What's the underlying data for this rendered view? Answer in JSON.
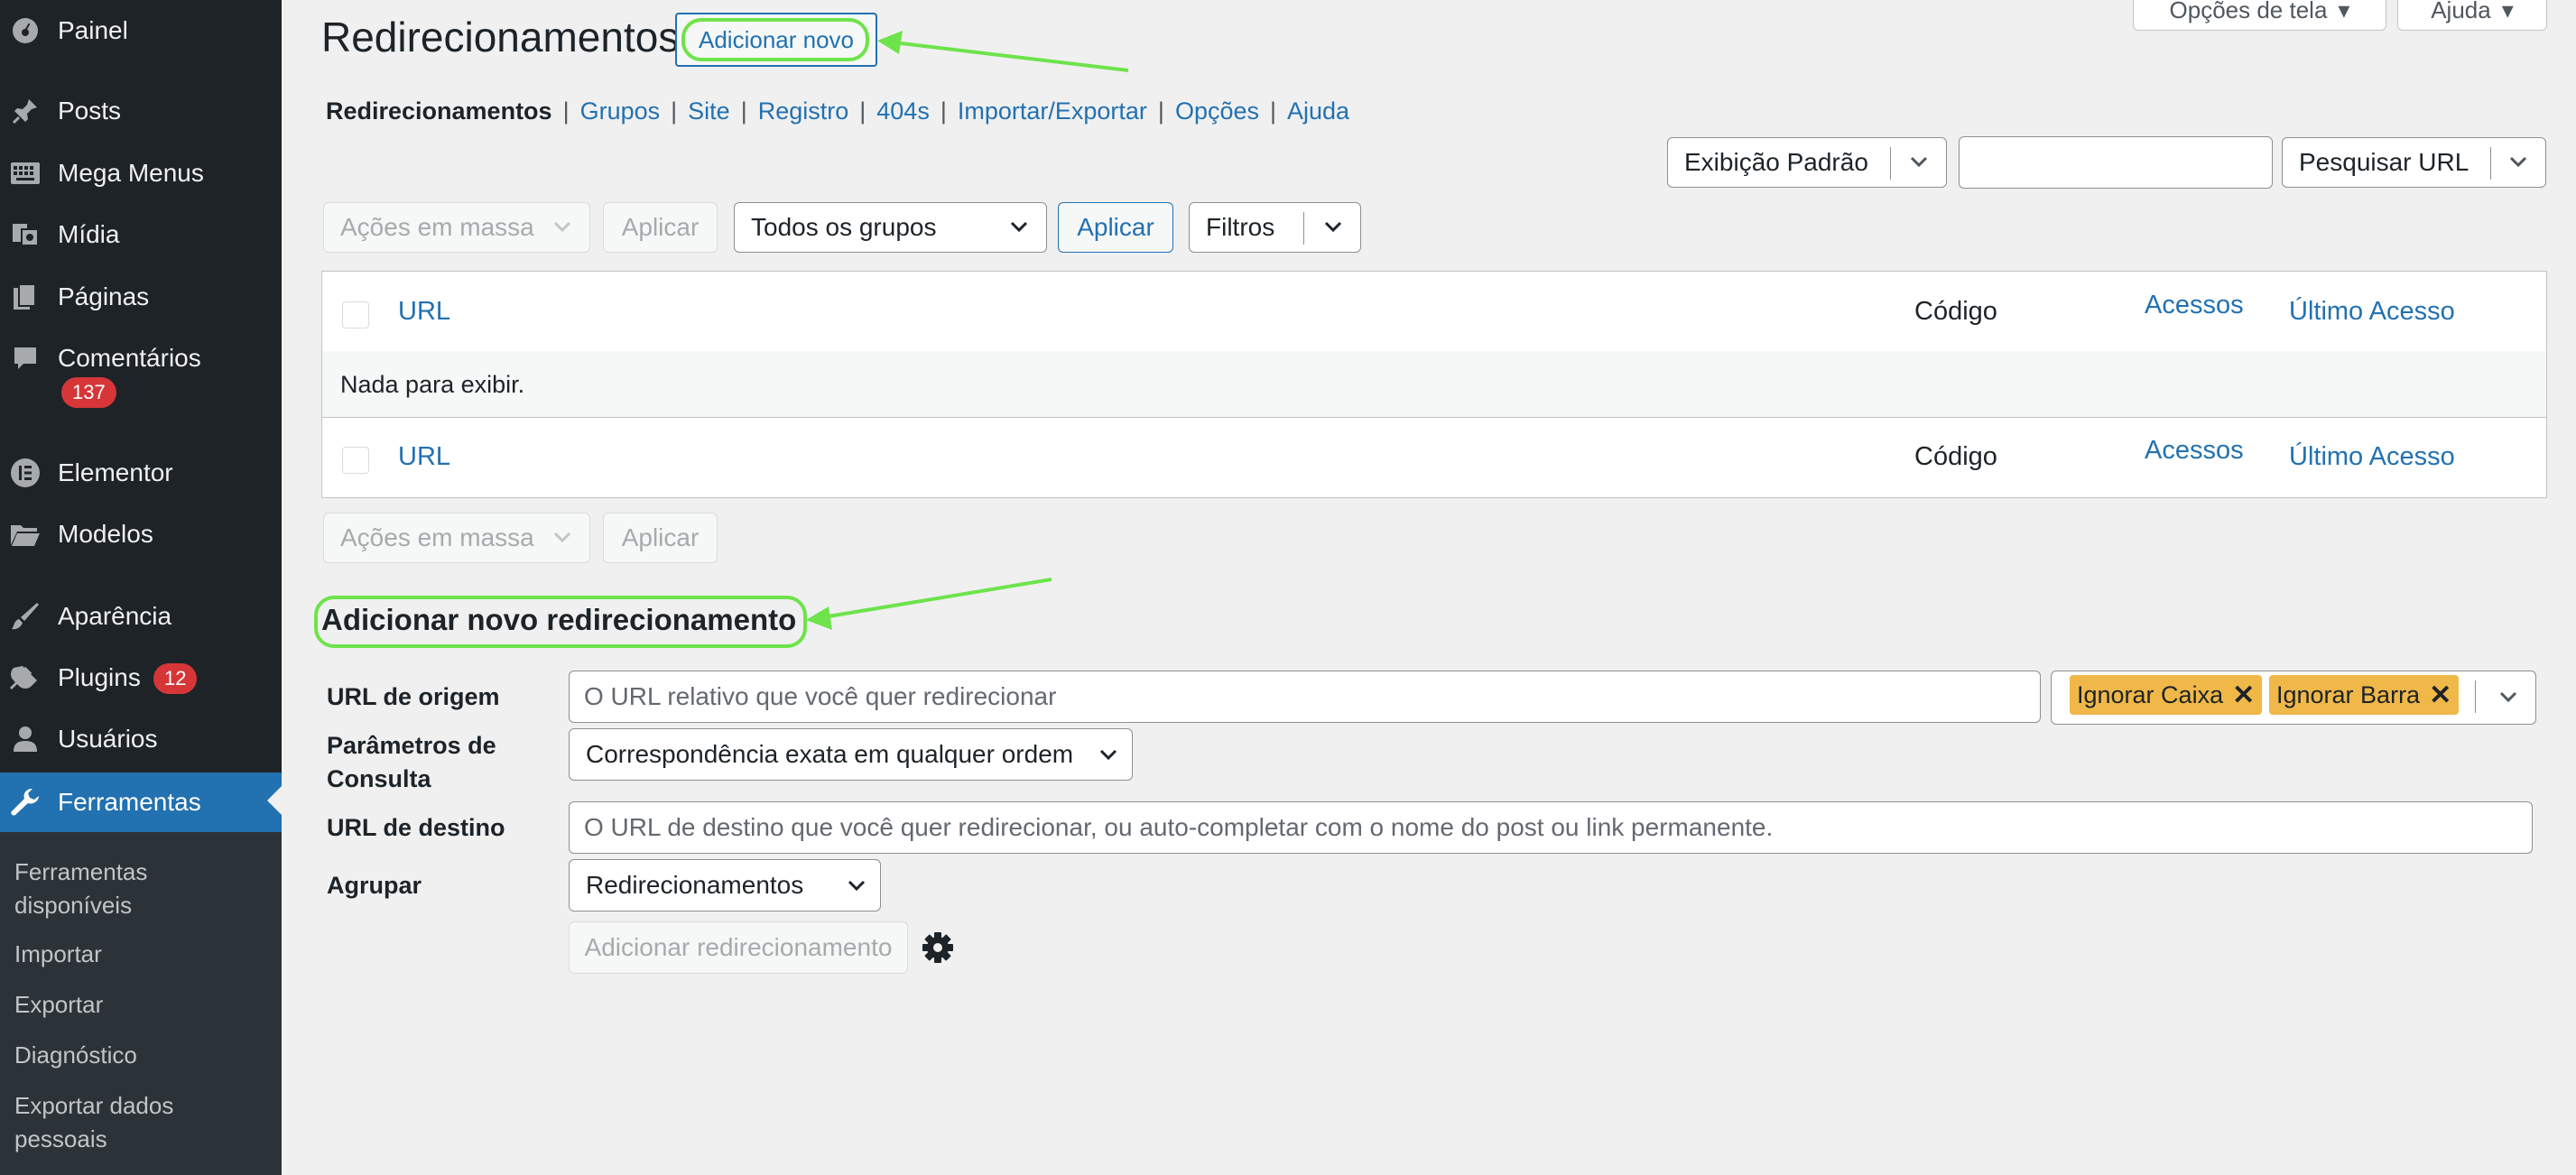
{
  "sidebar": {
    "items": [
      {
        "label": "Painel",
        "icon": "dashboard-icon"
      },
      {
        "label": "Posts",
        "icon": "pin-icon"
      },
      {
        "label": "Mega Menus",
        "icon": "keyboard-icon"
      },
      {
        "label": "Mídia",
        "icon": "media-icon"
      },
      {
        "label": "Páginas",
        "icon": "pages-icon"
      },
      {
        "label": "Comentários",
        "icon": "comment-icon",
        "badge": "137"
      },
      {
        "label": "Elementor",
        "icon": "elementor-icon"
      },
      {
        "label": "Modelos",
        "icon": "folder-icon"
      },
      {
        "label": "Aparência",
        "icon": "brush-icon"
      },
      {
        "label": "Plugins",
        "icon": "plugin-icon",
        "badge": "12"
      },
      {
        "label": "Usuários",
        "icon": "user-icon"
      },
      {
        "label": "Ferramentas",
        "icon": "wrench-icon",
        "current": true
      }
    ],
    "submenu": [
      "Ferramentas disponíveis",
      "Importar",
      "Exportar",
      "Diagnóstico",
      "Exportar dados pessoais"
    ]
  },
  "screen_options": "Opções de tela",
  "help": "Ajuda",
  "page_title": "Redirecionamentos",
  "add_new": "Adicionar novo",
  "subnav": [
    "Redirecionamentos",
    "Grupos",
    "Site",
    "Registro",
    "404s",
    "Importar/Exportar",
    "Opções",
    "Ajuda"
  ],
  "view_select": "Exibição Padrão",
  "search_value": "",
  "search_button": "Pesquisar URL",
  "bulk_actions": "Ações em massa",
  "apply": "Aplicar",
  "groups_select": "Todos os grupos",
  "apply_active": "Aplicar",
  "filters": "Filtros",
  "table": {
    "col_url": "URL",
    "col_code": "Código",
    "col_hits": "Acessos",
    "col_last": "Último Acesso",
    "empty": "Nada para exibir."
  },
  "form": {
    "title": "Adicionar novo redirecionamento",
    "source_label": "URL de origem",
    "source_placeholder": "O URL relativo que você quer redirecionar",
    "tags": [
      "Ignorar Caixa",
      "Ignorar Barra"
    ],
    "query_label": "Parâmetros de Consulta",
    "query_value": "Correspondência exata em qualquer ordem",
    "target_label": "URL de destino",
    "target_placeholder": "O URL de destino que você quer redirecionar, ou auto-completar com o nome do post ou link permanente.",
    "group_label": "Agrupar",
    "group_value": "Redirecionamentos",
    "submit": "Adicionar redirecionamento"
  },
  "colors": {
    "accent": "#2271b1",
    "sidebar": "#1d2327",
    "highlight": "#6ee34b",
    "tag": "#f0b849",
    "badge": "#d63638"
  }
}
